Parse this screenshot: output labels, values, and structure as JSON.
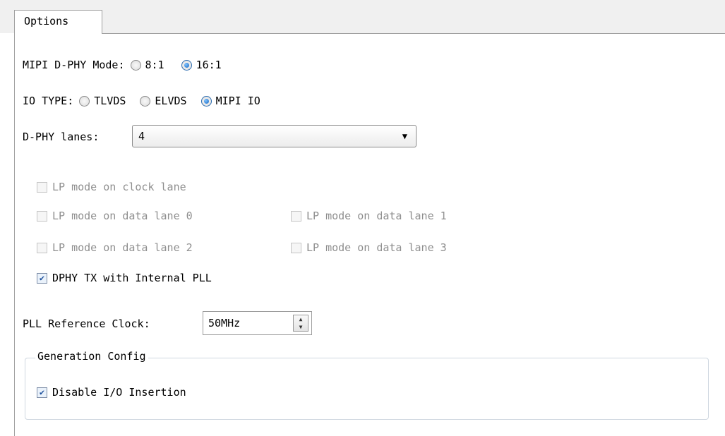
{
  "tab": {
    "label": "Options"
  },
  "mipi_mode": {
    "label": "MIPI D-PHY Mode:",
    "options": [
      {
        "label": "8:1",
        "selected": false
      },
      {
        "label": "16:1",
        "selected": true
      }
    ]
  },
  "io_type": {
    "label": "IO TYPE:",
    "options": [
      {
        "label": "TLVDS",
        "selected": false
      },
      {
        "label": "ELVDS",
        "selected": false
      },
      {
        "label": "MIPI IO",
        "selected": true
      }
    ]
  },
  "dphy_lanes": {
    "label": "D-PHY lanes:",
    "value": "4"
  },
  "lp_modes": {
    "clock": "LP mode on clock lane",
    "data0": "LP mode on data lane 0",
    "data1": "LP mode on data lane 1",
    "data2": "LP mode on data lane 2",
    "data3": "LP mode on data lane 3"
  },
  "dphy_tx_pll": {
    "label": "DPHY TX with Internal PLL",
    "checked": true
  },
  "pll_ref": {
    "label": "PLL Reference Clock:",
    "value": "50MHz"
  },
  "generation": {
    "title": "Generation Config",
    "disable_io": {
      "label": "Disable I/O Insertion",
      "checked": true
    }
  },
  "icons": {
    "combo_arrow": "chevron-down-icon",
    "spin_up": "spin-up-icon",
    "spin_down": "spin-down-icon"
  }
}
